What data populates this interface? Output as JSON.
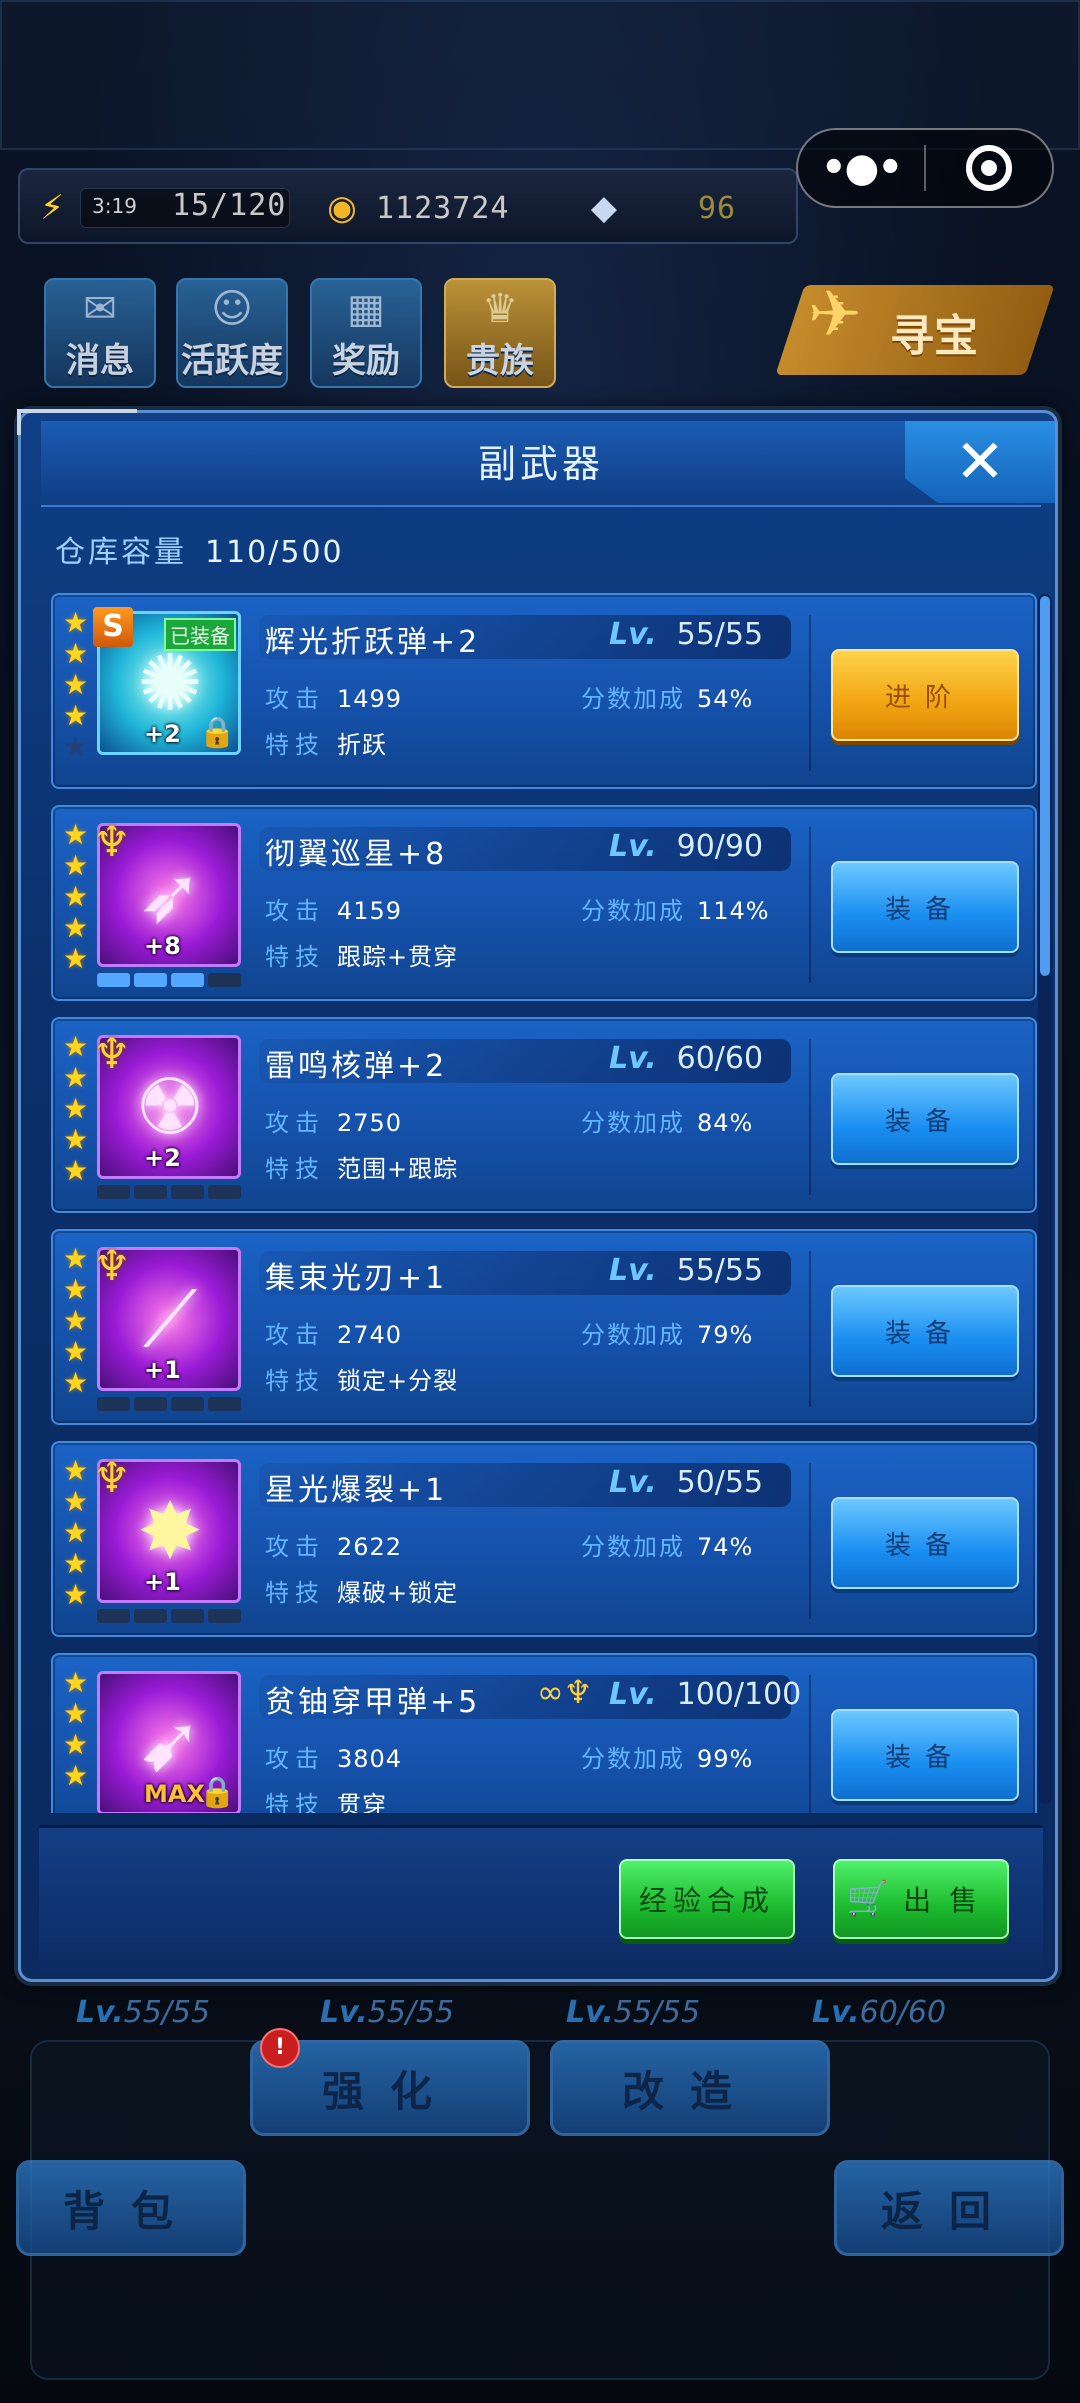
{
  "resources": {
    "energy": {
      "timer": "3:19",
      "value": "15/120",
      "icon": "lightning-icon"
    },
    "coins": {
      "value": "1123724",
      "icon": "coin-icon"
    },
    "diamonds": {
      "value": "96",
      "icon": "diamond-icon"
    }
  },
  "top_buttons": [
    {
      "label": "消息",
      "icon": "mail-icon"
    },
    {
      "label": "活跃度",
      "icon": "smile-badge-icon"
    },
    {
      "label": "奖励",
      "icon": "gift-icon"
    },
    {
      "label": "贵族",
      "icon": "crown-shield-icon"
    }
  ],
  "treasure_label": "寻宝",
  "dialog": {
    "title": "副武器",
    "capacity_label": "仓库容量",
    "capacity_value": "110/500",
    "close_icon": "close-icon"
  },
  "items": [
    {
      "name": "辉光折跃弹+2",
      "level_label": "Lv.",
      "level": "55/55",
      "attack_label": "攻击",
      "attack": "1499",
      "score_label": "分数加成",
      "score": "54%",
      "skill_label": "特技",
      "skill": "折跃",
      "stars": 5,
      "plus": "+2",
      "badge": "S",
      "equipped": "已装备",
      "locked": true,
      "action": "进阶",
      "action_style": "gold",
      "thumb_style": "blue"
    },
    {
      "name": "彻翼巡星+8",
      "level_label": "Lv.",
      "level": "90/90",
      "attack_label": "攻击",
      "attack": "4159",
      "score_label": "分数加成",
      "score": "114%",
      "skill_label": "特技",
      "skill": "跟踪+贯穿",
      "stars": 5,
      "plus": "+8",
      "action": "装备",
      "action_style": "blue",
      "thumb_style": "purple"
    },
    {
      "name": "雷鸣核弹+2",
      "level_label": "Lv.",
      "level": "60/60",
      "attack_label": "攻击",
      "attack": "2750",
      "score_label": "分数加成",
      "score": "84%",
      "skill_label": "特技",
      "skill": "范围+跟踪",
      "stars": 5,
      "plus": "+2",
      "action": "装备",
      "action_style": "blue",
      "thumb_style": "purple"
    },
    {
      "name": "集束光刃+1",
      "level_label": "Lv.",
      "level": "55/55",
      "attack_label": "攻击",
      "attack": "2740",
      "score_label": "分数加成",
      "score": "79%",
      "skill_label": "特技",
      "skill": "锁定+分裂",
      "stars": 5,
      "plus": "+1",
      "action": "装备",
      "action_style": "blue",
      "thumb_style": "purple"
    },
    {
      "name": "星光爆裂+1",
      "level_label": "Lv.",
      "level": "50/55",
      "attack_label": "攻击",
      "attack": "2622",
      "score_label": "分数加成",
      "score": "74%",
      "skill_label": "特技",
      "skill": "爆破+锁定",
      "stars": 5,
      "plus": "+1",
      "action": "装备",
      "action_style": "blue",
      "thumb_style": "purple"
    },
    {
      "name": "贫铀穿甲弹+5",
      "level_label": "Lv.",
      "level": "100/100",
      "attack_label": "攻击",
      "attack": "3804",
      "score_label": "分数加成",
      "score": "99%",
      "skill_label": "特技",
      "skill": "贯穿",
      "stars": 4,
      "plus": "MAX",
      "locked": true,
      "action": "装备",
      "action_style": "blue",
      "thumb_style": "purple"
    }
  ],
  "footer": {
    "exp_merge_label": "经验合成",
    "sell_label": "出售"
  },
  "underlying": {
    "levels": [
      "55/55",
      "55/55",
      "55/55",
      "60/60"
    ],
    "level_prefix": "Lv.",
    "strengthen_label": "强化",
    "modify_label": "改造",
    "bag_label": "背包",
    "back_label": "返回",
    "notice_mark": "!"
  }
}
